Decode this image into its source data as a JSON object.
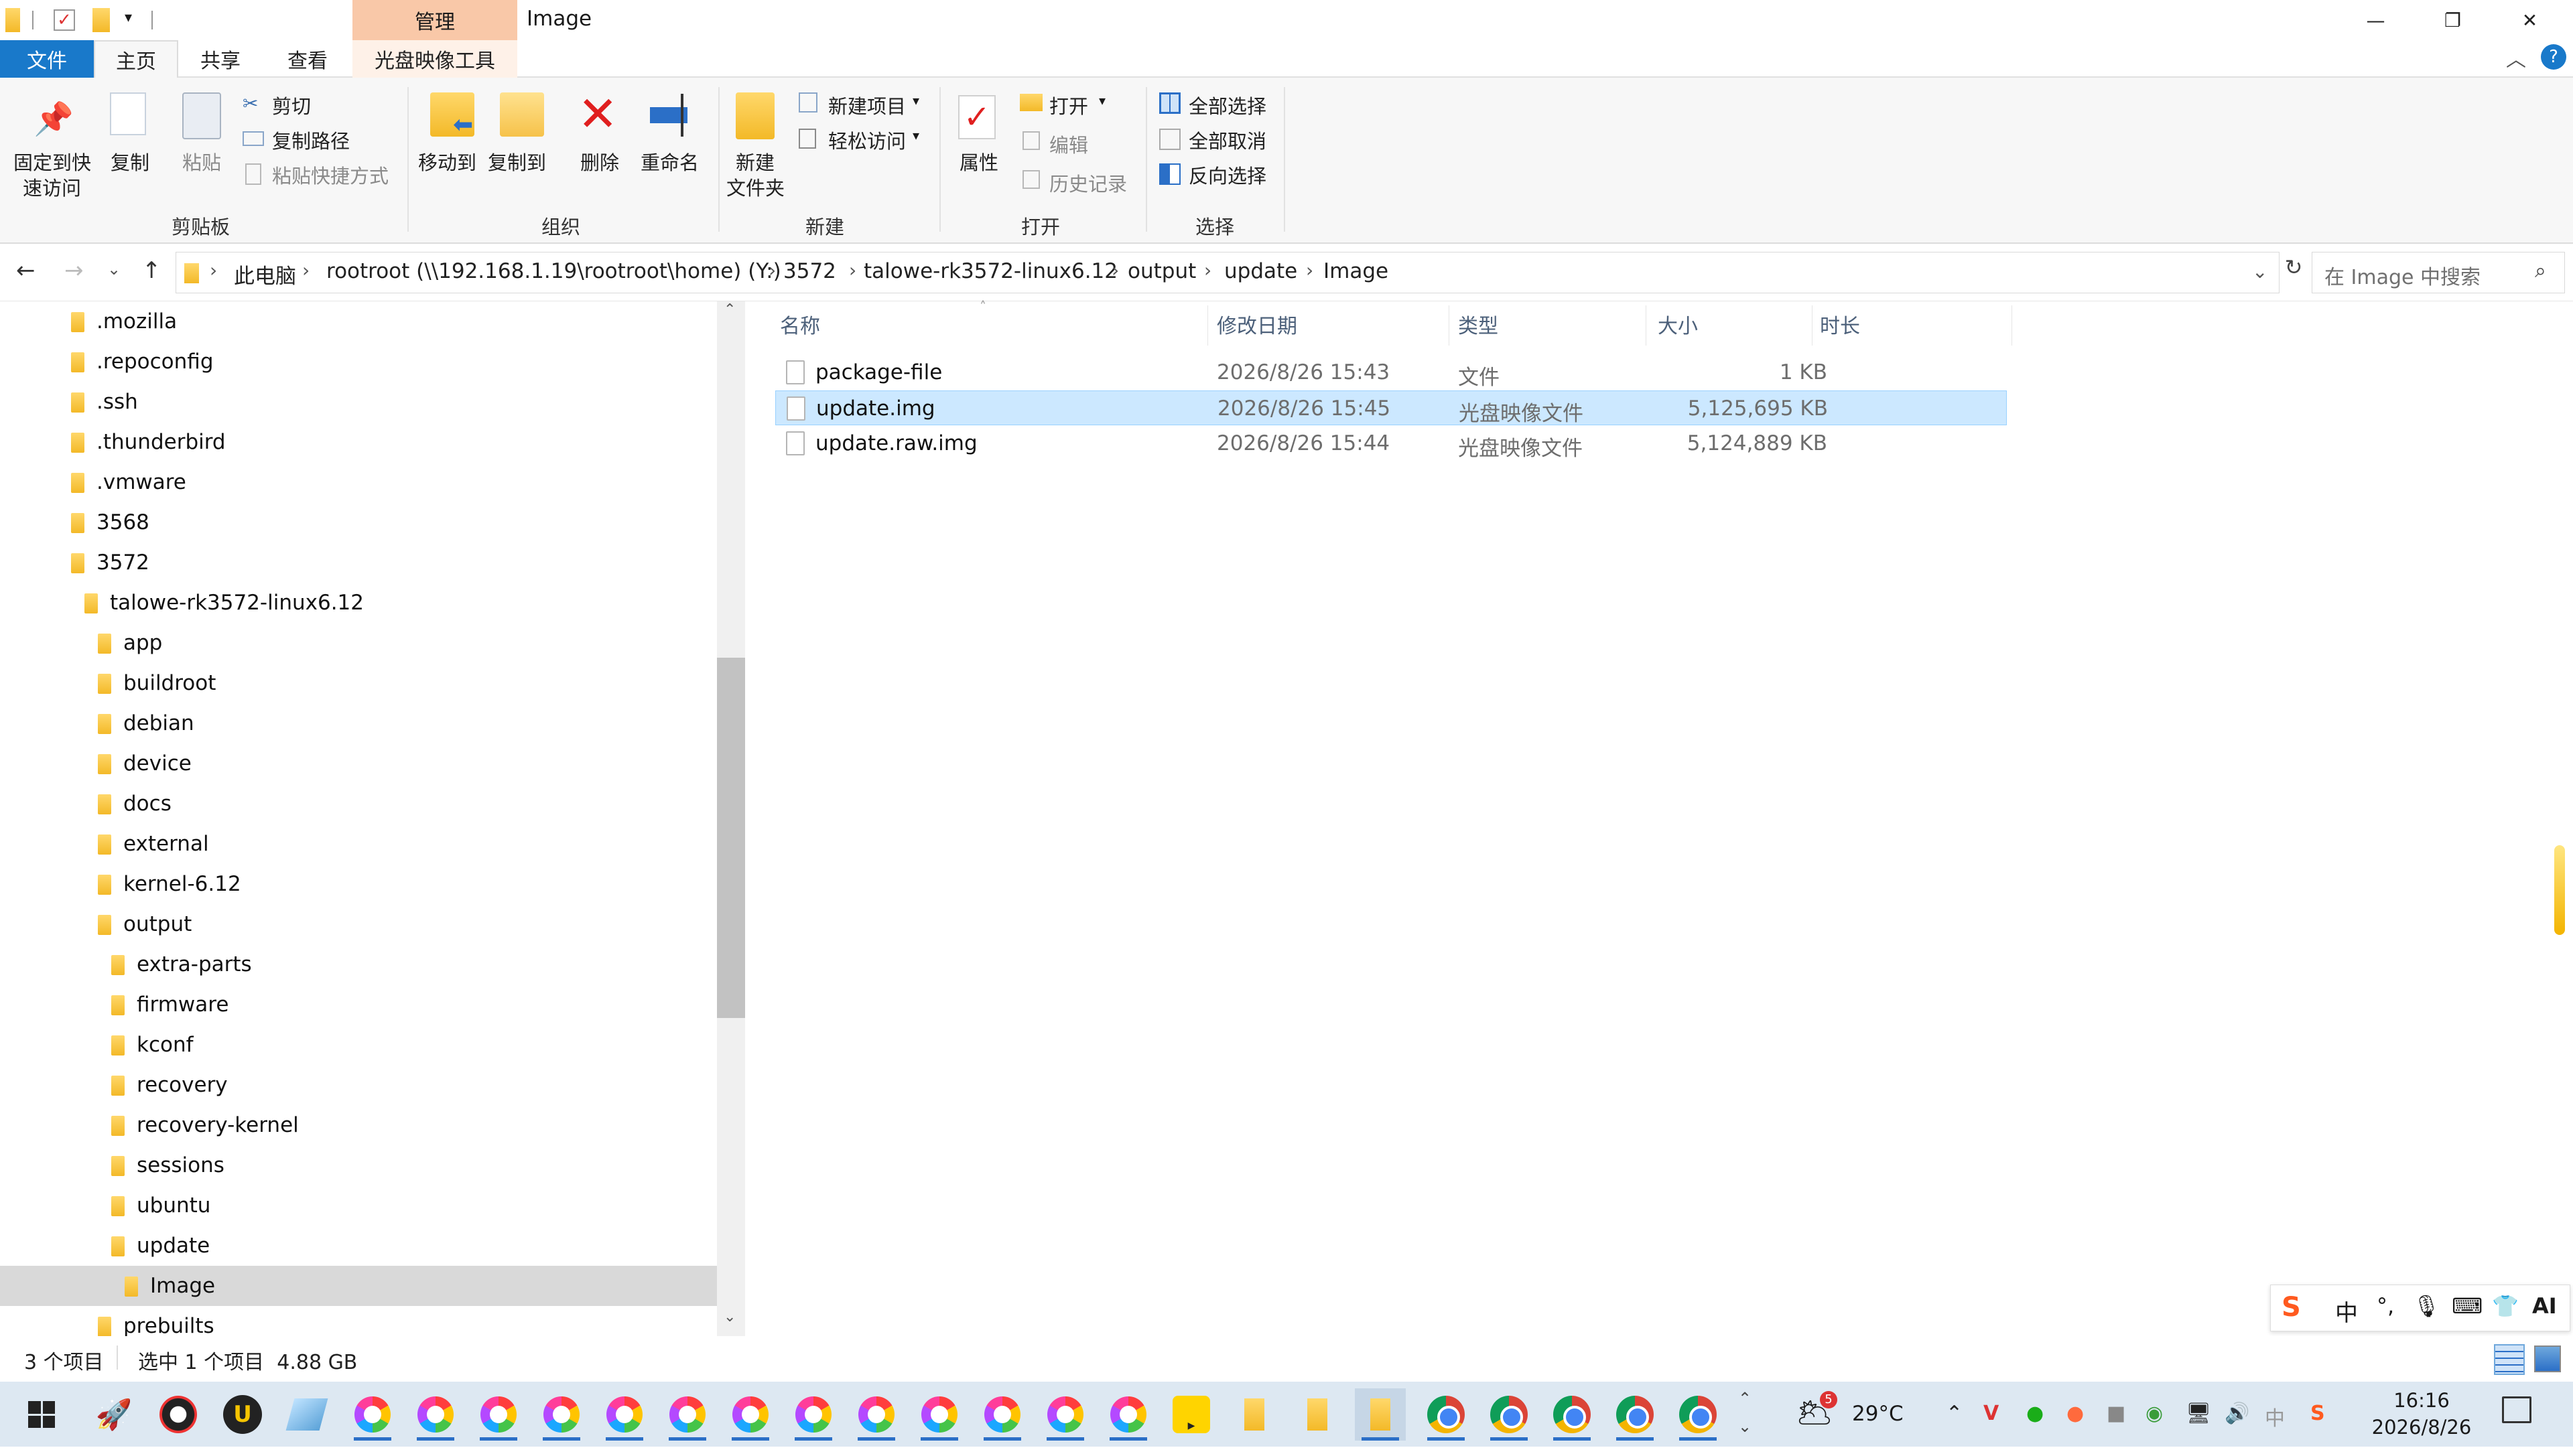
{
  "title": {
    "tool_tab": "管理",
    "window_title": "Image"
  },
  "tabs": [
    {
      "label": "文件"
    },
    {
      "label": "主页"
    },
    {
      "label": "共享"
    },
    {
      "label": "查看"
    },
    {
      "label": "光盘映像工具"
    }
  ],
  "ribbon": {
    "clipboard": {
      "pin_label_1": "固定到快",
      "pin_label_2": "速访问",
      "copy": "复制",
      "paste": "粘贴",
      "cut": "剪切",
      "copy_path": "复制路径",
      "paste_shortcut": "粘贴快捷方式",
      "group": "剪贴板"
    },
    "organize": {
      "move_to": "移动到",
      "copy_to": "复制到",
      "delete": "删除",
      "rename": "重命名",
      "group": "组织"
    },
    "new": {
      "new_folder_1": "新建",
      "new_folder_2": "文件夹",
      "new_item": "新建项目",
      "easy_access": "轻松访问",
      "group": "新建"
    },
    "open": {
      "properties": "属性",
      "open": "打开",
      "edit": "编辑",
      "history": "历史记录",
      "group": "打开"
    },
    "select": {
      "select_all": "全部选择",
      "select_none": "全部取消",
      "invert": "反向选择",
      "group": "选择"
    }
  },
  "address": {
    "crumbs": [
      "此电脑",
      "rootroot (\\\\192.168.1.19\\rootroot\\home) (Y:)",
      "3572",
      "talowe-rk3572-linux6.12",
      "output",
      "update",
      "Image"
    ],
    "search_placeholder": "在 Image 中搜索"
  },
  "nav_tree": [
    {
      "label": ".mozilla",
      "level": 0
    },
    {
      "label": ".repoconfig",
      "level": 0
    },
    {
      "label": ".ssh",
      "level": 0
    },
    {
      "label": ".thunderbird",
      "level": 0
    },
    {
      "label": ".vmware",
      "level": 0
    },
    {
      "label": "3568",
      "level": 0
    },
    {
      "label": "3572",
      "level": 0
    },
    {
      "label": "talowe-rk3572-linux6.12",
      "level": 1
    },
    {
      "label": "app",
      "level": 2
    },
    {
      "label": "buildroot",
      "level": 2
    },
    {
      "label": "debian",
      "level": 2
    },
    {
      "label": "device",
      "level": 2
    },
    {
      "label": "docs",
      "level": 2
    },
    {
      "label": "external",
      "level": 2
    },
    {
      "label": "kernel-6.12",
      "level": 2
    },
    {
      "label": "output",
      "level": 2
    },
    {
      "label": "extra-parts",
      "level": 3
    },
    {
      "label": "firmware",
      "level": 3
    },
    {
      "label": "kconf",
      "level": 3
    },
    {
      "label": "recovery",
      "level": 3
    },
    {
      "label": "recovery-kernel",
      "level": 3
    },
    {
      "label": "sessions",
      "level": 3
    },
    {
      "label": "ubuntu",
      "level": 3
    },
    {
      "label": "update",
      "level": 3
    },
    {
      "label": "Image",
      "level": 4,
      "selected": true
    },
    {
      "label": "prebuilts",
      "level": 2
    }
  ],
  "columns": [
    "名称",
    "修改日期",
    "类型",
    "大小",
    "时长"
  ],
  "files": [
    {
      "name": "package-file",
      "modified": "2026/8/26 15:43",
      "type": "文件",
      "size": "1 KB",
      "selected": false
    },
    {
      "name": "update.img",
      "modified": "2026/8/26 15:45",
      "type": "光盘映像文件",
      "size": "5,125,695 KB",
      "selected": true
    },
    {
      "name": "update.raw.img",
      "modified": "2026/8/26 15:44",
      "type": "光盘映像文件",
      "size": "5,124,889 KB",
      "selected": false
    }
  ],
  "status": {
    "count": "3 个项目",
    "selection": "选中 1 个项目  4.88 GB"
  },
  "ime": {
    "mode": "中"
  },
  "taskbar": {
    "weather_badge": "5",
    "temperature": "29°C",
    "time": "16:16",
    "date": "2026/8/26",
    "lang": "中"
  },
  "colors": {
    "file_tab": "#1979ca",
    "tool_tab": "#f9c8a8",
    "selection": "#cce8ff",
    "taskbar": "#dde8f2"
  }
}
